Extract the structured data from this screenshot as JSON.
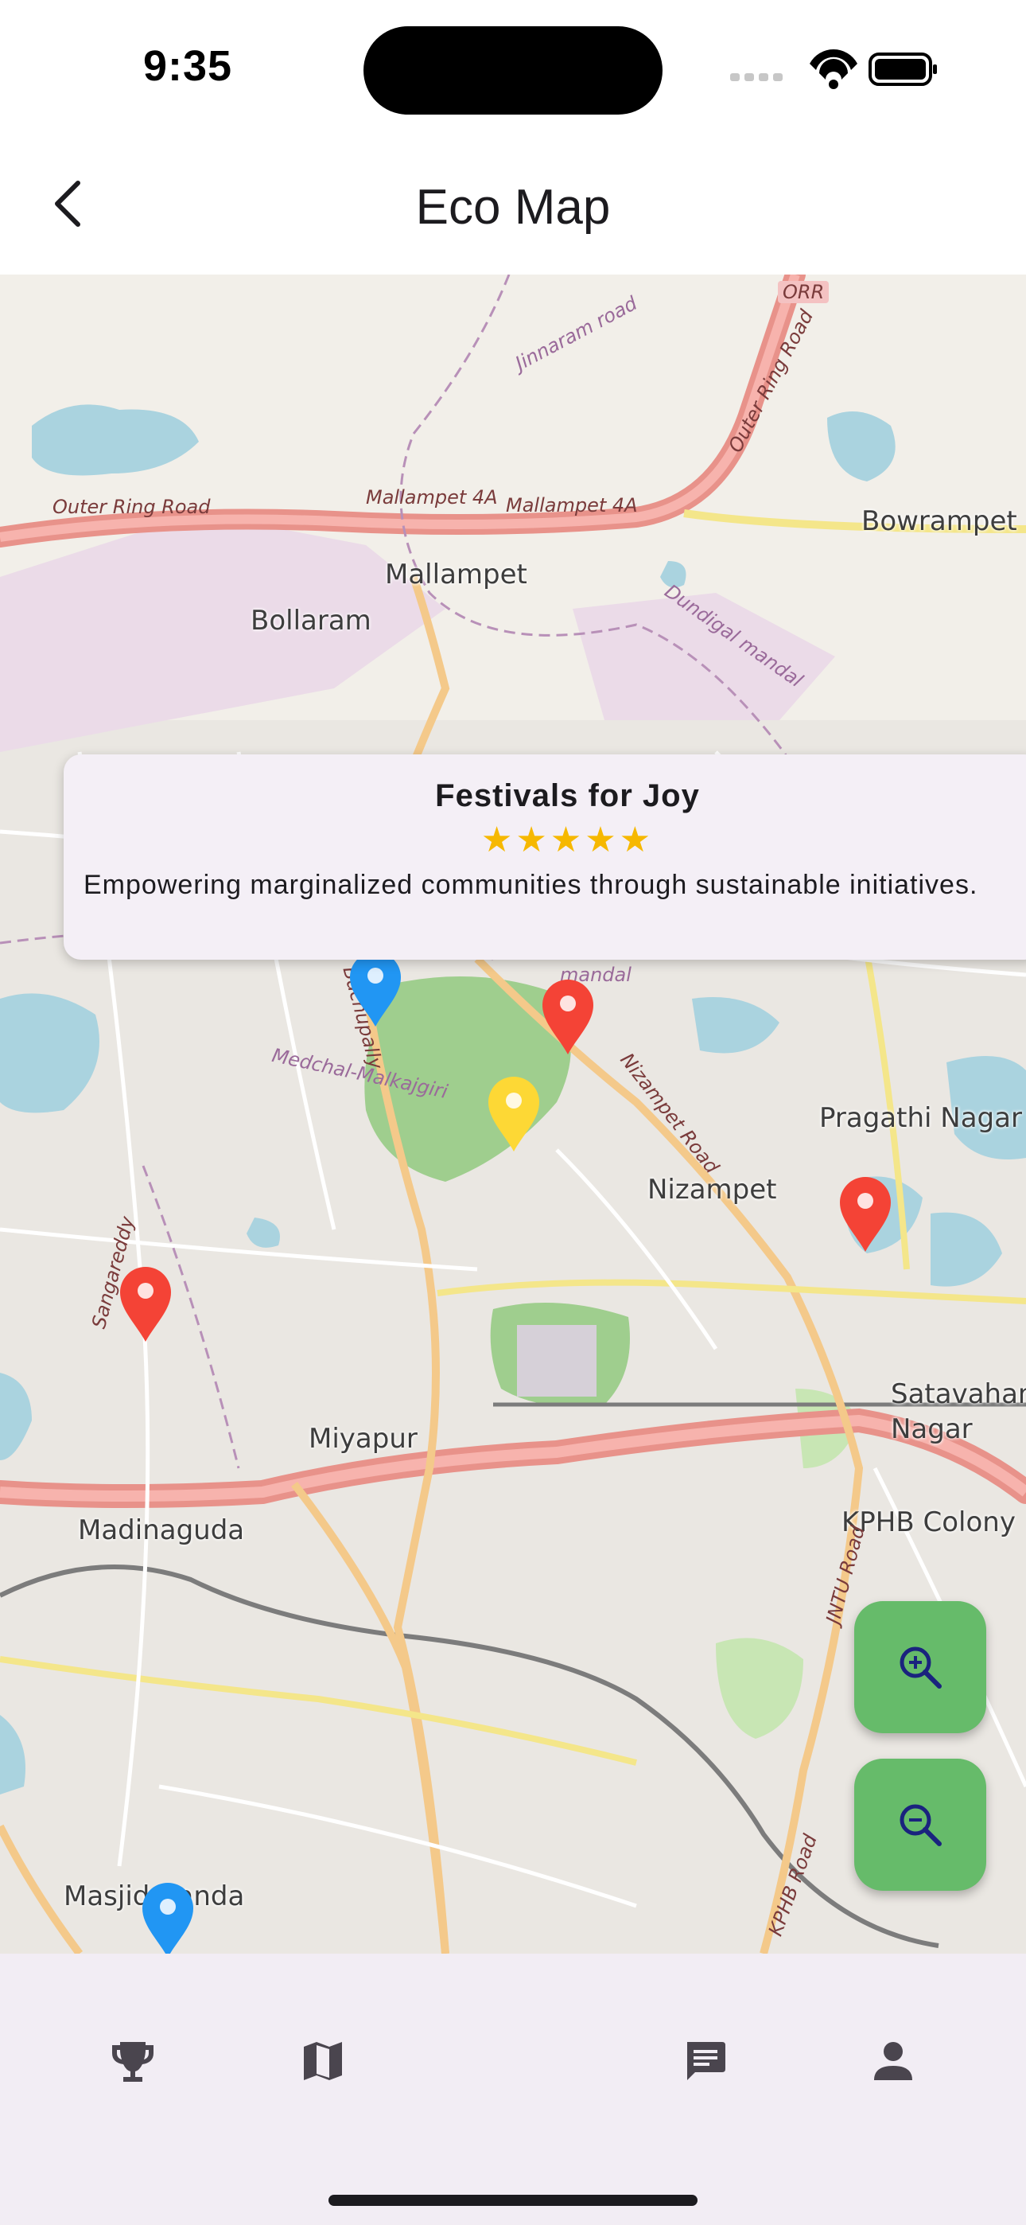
{
  "status_bar": {
    "time": "9:35",
    "icons": [
      "signal-icon",
      "wifi-icon",
      "battery-icon"
    ]
  },
  "app_bar": {
    "title": "Eco Map",
    "back_icon": "back-arrow-icon"
  },
  "map": {
    "place_labels": [
      "Bowrampet",
      "Mallampet",
      "Bollaram",
      "Pragathi Nagar",
      "Nizampet",
      "Satavahana Nagar",
      "Miyapur",
      "Madinaguda",
      "KPHB Colony",
      "Masjid Banda"
    ],
    "road_labels": [
      "Outer Ring Road",
      "Mallampet 4A",
      "Mallampet 4A",
      "ORR",
      "Jinnaram road",
      "Outer Ring Road",
      "Dundigal mandal",
      "Medchal-Malkajgiri",
      "Nizampet Road",
      "Sangareddy",
      "JNTU Road",
      "KPHB Road",
      "mandal",
      "Bachupally"
    ],
    "pins": [
      {
        "color": "#2196f3",
        "label": "blue marker"
      },
      {
        "color": "#f44336",
        "label": "red marker"
      },
      {
        "color": "#fdd835",
        "label": "yellow marker"
      },
      {
        "color": "#f44336",
        "label": "red marker"
      },
      {
        "color": "#f44336",
        "label": "red marker"
      },
      {
        "color": "#2196f3",
        "label": "blue marker"
      }
    ]
  },
  "info_card": {
    "title": "Festivals for Joy",
    "stars": "★★★★★",
    "rating": 5,
    "description": "Empowering marginalized communities through sustainable initiatives."
  },
  "zoom": {
    "zoom_in_icon": "zoom-in-icon",
    "zoom_out_icon": "zoom-out-icon"
  },
  "bottom_nav": {
    "items": [
      "trophy-icon",
      "map-icon",
      "chat-icon",
      "person-icon"
    ]
  },
  "colors": {
    "fab": "#66bb6a",
    "nav_bg": "#f2edf4",
    "card_bg": "#f4eff6",
    "star": "#f6b800",
    "map_bg": "#f2efe9",
    "park": "#9fce8e",
    "water": "#aad3df",
    "highway": "#e8928a",
    "trunk": "#f4c98a"
  }
}
